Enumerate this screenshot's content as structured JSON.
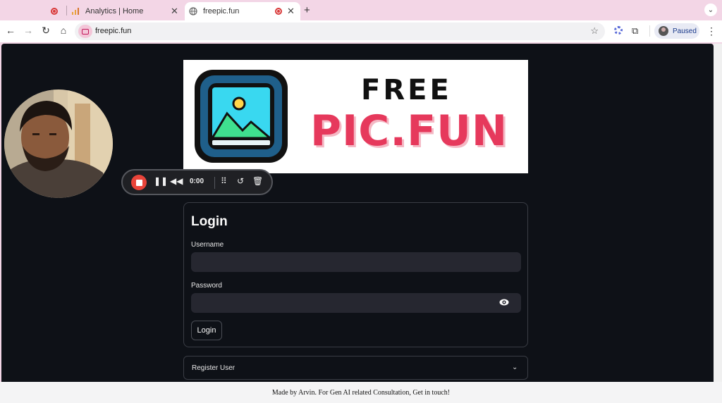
{
  "browser": {
    "tabs": [
      {
        "title": "",
        "icon": "recording-dot-icon"
      },
      {
        "title": "Analytics | Home",
        "icon": "analytics-icon"
      },
      {
        "title": "freepic.fun",
        "icon": "globe-icon",
        "active": true
      }
    ],
    "address": "freepic.fun",
    "profile_label": "Paused"
  },
  "logo": {
    "line1": "FREE",
    "line2": "PIC.FUN",
    "colors": {
      "primary": "#e6395c",
      "frame": "#1f5f8a",
      "sky": "#39d8f0",
      "hill": "#3fe08f"
    }
  },
  "recorder": {
    "time": "0:00"
  },
  "login": {
    "title": "Login",
    "username_label": "Username",
    "username_value": "",
    "password_label": "Password",
    "password_value": "",
    "button_label": "Login"
  },
  "register": {
    "label": "Register User"
  },
  "footer": {
    "text": "Made by Arvin. For Gen AI related Consultation, Get in touch!"
  },
  "colors": {
    "page_bg": "#0e1117",
    "input_bg": "#262730",
    "record_red": "#e8443a",
    "tabbar_bg": "#f3d6e6"
  }
}
